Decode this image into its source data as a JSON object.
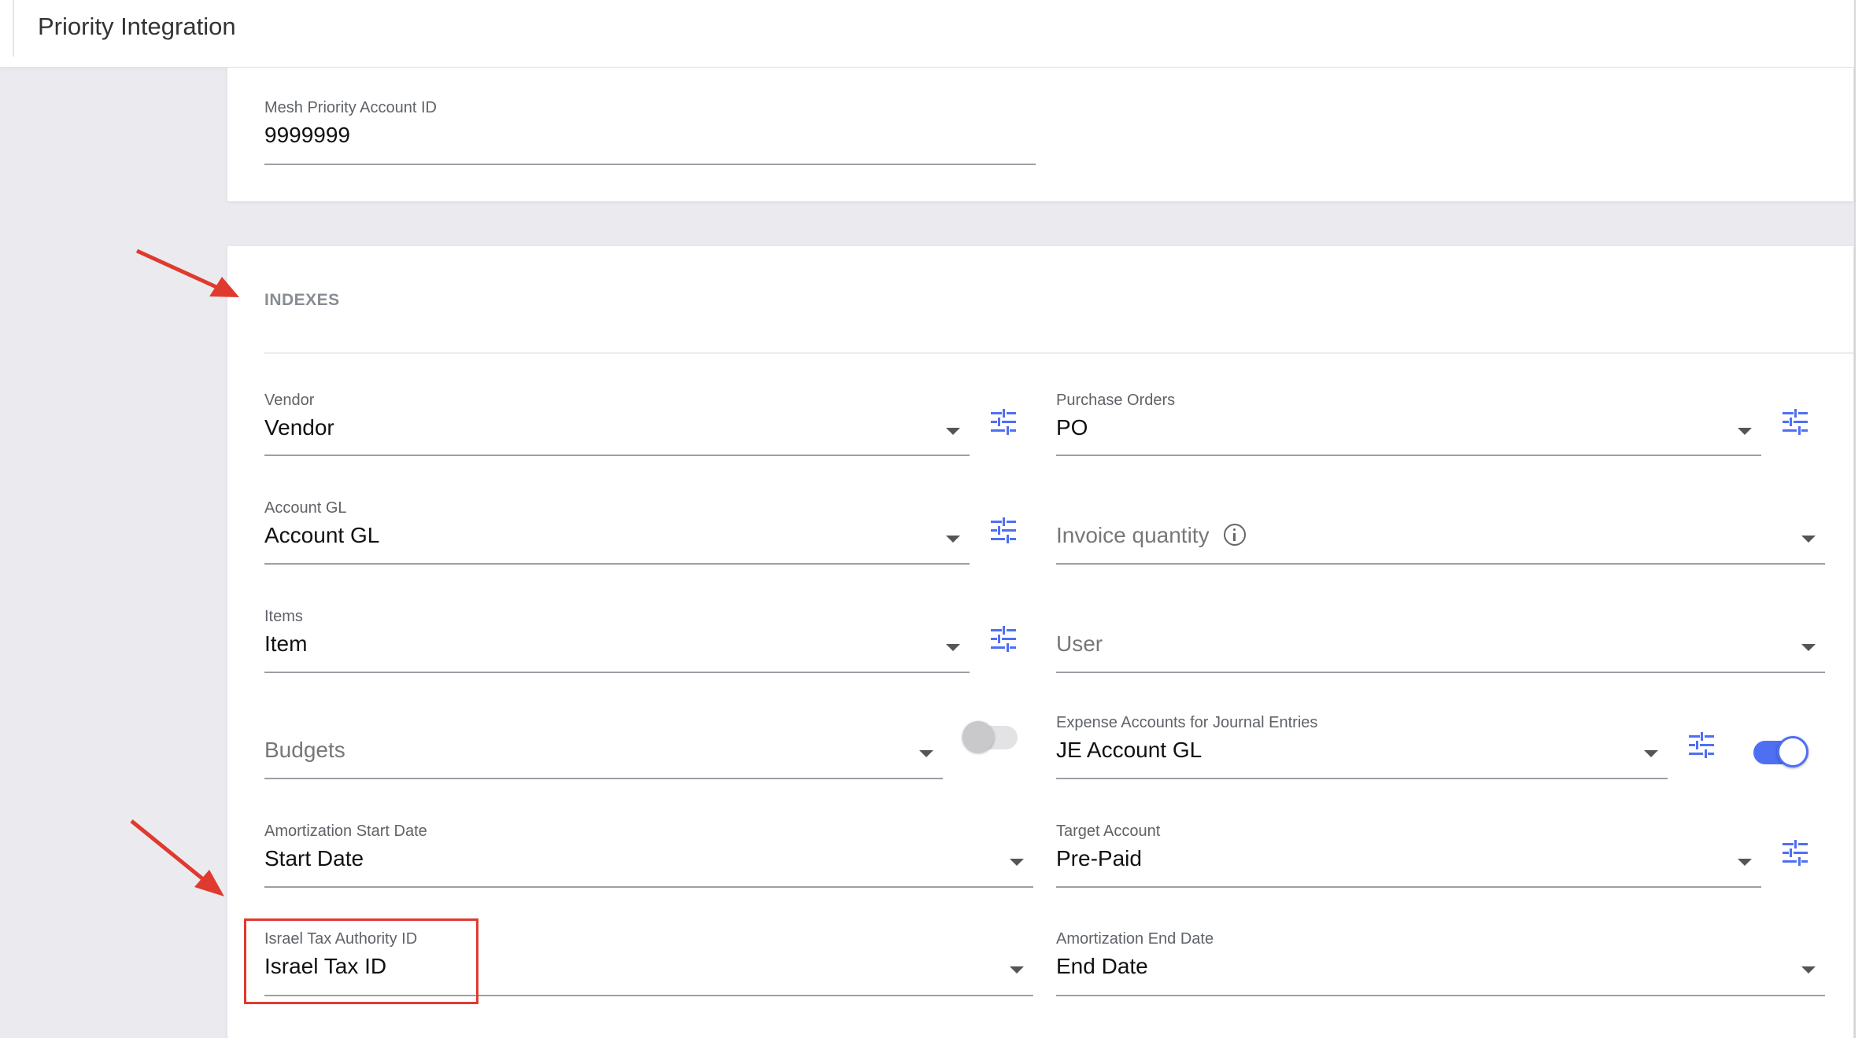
{
  "header": {
    "title": "Priority Integration"
  },
  "account": {
    "label": "Mesh Priority Account ID",
    "value": "9999999"
  },
  "indexes": {
    "heading": "INDEXES",
    "vendor": {
      "label": "Vendor",
      "value": "Vendor"
    },
    "purchase_orders": {
      "label": "Purchase Orders",
      "value": "PO"
    },
    "account_gl": {
      "label": "Account GL",
      "value": "Account GL"
    },
    "invoice_quantity": {
      "placeholder": "Invoice quantity"
    },
    "items": {
      "label": "Items",
      "value": "Item"
    },
    "user": {
      "placeholder": "User"
    },
    "budgets": {
      "placeholder": "Budgets",
      "toggle": "off"
    },
    "expense_accounts": {
      "label": "Expense Accounts for Journal Entries",
      "value": "JE Account GL",
      "toggle": "on"
    },
    "amortization_start": {
      "label": "Amortization Start Date",
      "value": "Start Date"
    },
    "target_account": {
      "label": "Target Account",
      "value": "Pre-Paid"
    },
    "israel_tax": {
      "label": "Israel Tax Authority ID",
      "value": "Israel Tax ID"
    },
    "amortization_end": {
      "label": "Amortization End Date",
      "value": "End Date"
    }
  },
  "colors": {
    "accent": "#4f6ff3",
    "annotation": "#e03a2f",
    "background": "#ebebef"
  },
  "icons": [
    "tune-icon",
    "info-icon",
    "dropdown-caret-icon",
    "annotation-arrow-icon"
  ]
}
